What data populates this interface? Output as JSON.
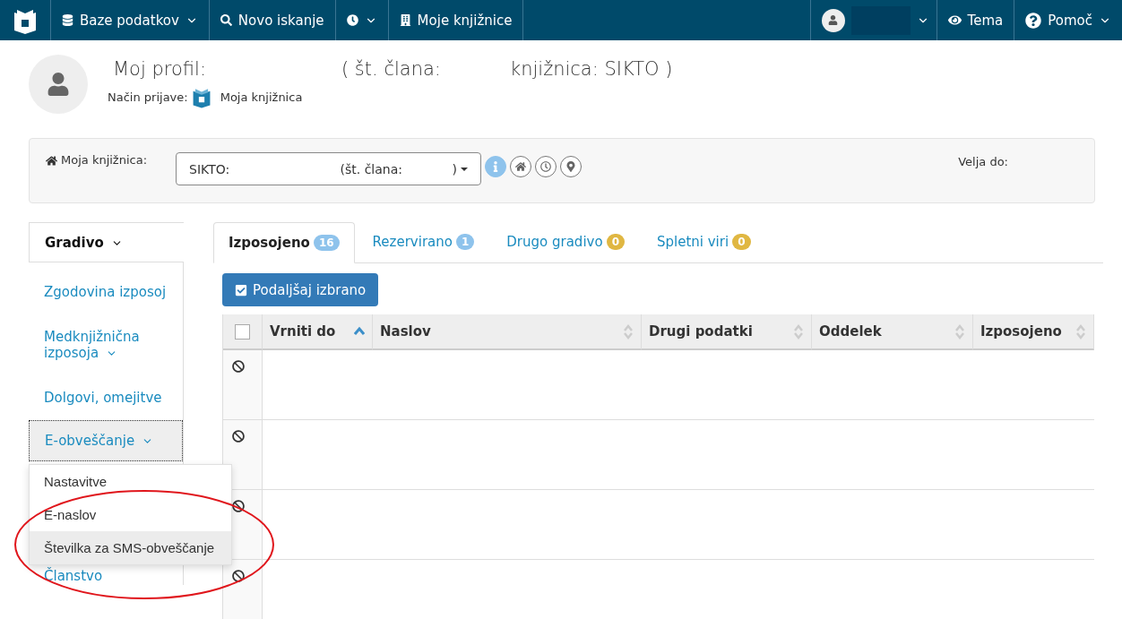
{
  "navbar": {
    "items": [
      {
        "label": "Baze podatkov",
        "caret": true
      },
      {
        "label": "Novo iskanje",
        "caret": false
      },
      {
        "caret": true
      },
      {
        "label": "Moje knjižnice",
        "caret": false
      }
    ],
    "right": [
      {
        "kind": "user",
        "caret": true
      },
      {
        "label": "Tema",
        "caret": false
      },
      {
        "label": "Pomoč",
        "caret": true
      }
    ]
  },
  "profile": {
    "title": "Moj profil:",
    "member_label": "( št. člana:",
    "library": "knjižnica: SIKTO )",
    "login_label": "Način prijave:",
    "login_method": "Moja knjižnica"
  },
  "library_panel": {
    "label": "Moja knjižnica:",
    "select_prefix": "SIKTO:",
    "select_member": "(št. člana:",
    "select_close": ")",
    "valid_label": "Velja do:"
  },
  "sidebar": {
    "items": [
      {
        "label": "Gradivo",
        "selected": true,
        "caret": true
      },
      {
        "label": "Zgodovina izposoj",
        "selected": false,
        "caret": false
      },
      {
        "label": "Medknjižnična izposoja",
        "selected": false,
        "caret": true
      },
      {
        "label": "Dolgovi, omejitve",
        "selected": false,
        "caret": false
      },
      {
        "label": "E-obveščanje",
        "selected": false,
        "caret": true,
        "expanded": true
      },
      {
        "label": "Članstvo",
        "selected": false,
        "caret": false
      }
    ],
    "dropdown": [
      {
        "label": "Nastavitve",
        "selected": false
      },
      {
        "label": "E-naslov",
        "selected": false
      },
      {
        "label": "Številka za SMS-obveščanje",
        "selected": true
      }
    ]
  },
  "tabs": [
    {
      "label": "Izposojeno",
      "count": "16",
      "selected": true,
      "color": "#8ec3ec"
    },
    {
      "label": "Rezervirano",
      "count": "1",
      "selected": false,
      "color": "#8ec3ec"
    },
    {
      "label": "Drugo gradivo",
      "count": "0",
      "selected": false,
      "color": "#e0b742"
    },
    {
      "label": "Spletni viri",
      "count": "0",
      "selected": false,
      "color": "#e0b742"
    }
  ],
  "renew_button": "Podaljšaj izbrano",
  "table": {
    "select_all_checked": false,
    "columns": [
      {
        "label": "Vrniti do",
        "sorted": true
      },
      {
        "label": "Naslov",
        "sorted": false
      },
      {
        "label": "Drugi podatki",
        "sorted": false
      },
      {
        "label": "Oddelek",
        "sorted": false
      },
      {
        "label": "Izposojeno",
        "sorted": false
      }
    ],
    "rows": [
      {
        "kind": "blocked"
      },
      {
        "kind": "blocked"
      },
      {
        "kind": "blocked"
      },
      {
        "kind": "blocked"
      }
    ]
  }
}
